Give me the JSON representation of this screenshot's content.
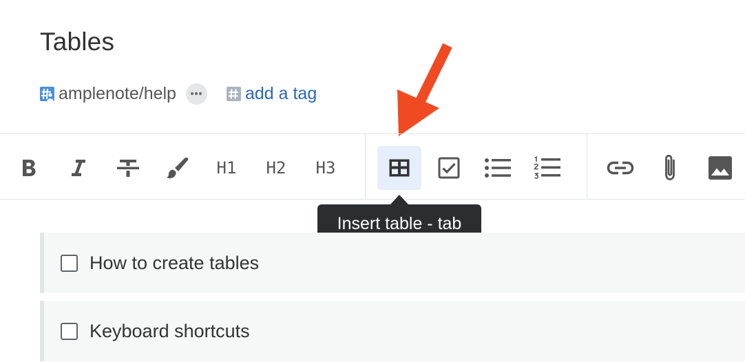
{
  "note": {
    "title": "Tables",
    "tags": {
      "owner_tag": "amplenote/help",
      "add_tag_label": "add a tag"
    }
  },
  "toolbar": {
    "buttons": [
      {
        "name": "bold",
        "icon": "bold-icon"
      },
      {
        "name": "italic",
        "icon": "italic-icon"
      },
      {
        "name": "strikethrough",
        "icon": "strikethrough-icon"
      },
      {
        "name": "highlight",
        "icon": "paintbrush-icon"
      },
      {
        "name": "heading-1",
        "label": "H1"
      },
      {
        "name": "heading-2",
        "label": "H2"
      },
      {
        "name": "heading-3",
        "label": "H3"
      },
      {
        "name": "insert-table",
        "icon": "table-icon",
        "active": true
      },
      {
        "name": "task",
        "icon": "checkbox-icon"
      },
      {
        "name": "bullet-list",
        "icon": "bullet-list-icon"
      },
      {
        "name": "numbered-list",
        "icon": "numbered-list-icon"
      },
      {
        "name": "link",
        "icon": "link-icon"
      },
      {
        "name": "attachment",
        "icon": "paperclip-icon"
      },
      {
        "name": "image",
        "icon": "image-icon"
      }
    ],
    "tooltip": "Insert table - tab"
  },
  "tasks": [
    {
      "label": "How to create tables",
      "checked": false
    },
    {
      "label": "Keyboard shortcuts",
      "checked": false
    }
  ],
  "colors": {
    "accent_link": "#2a66b8",
    "annotation_arrow": "#f04a23",
    "tooltip_bg": "#2b2d2f",
    "active_button_bg": "#e6eefb"
  }
}
